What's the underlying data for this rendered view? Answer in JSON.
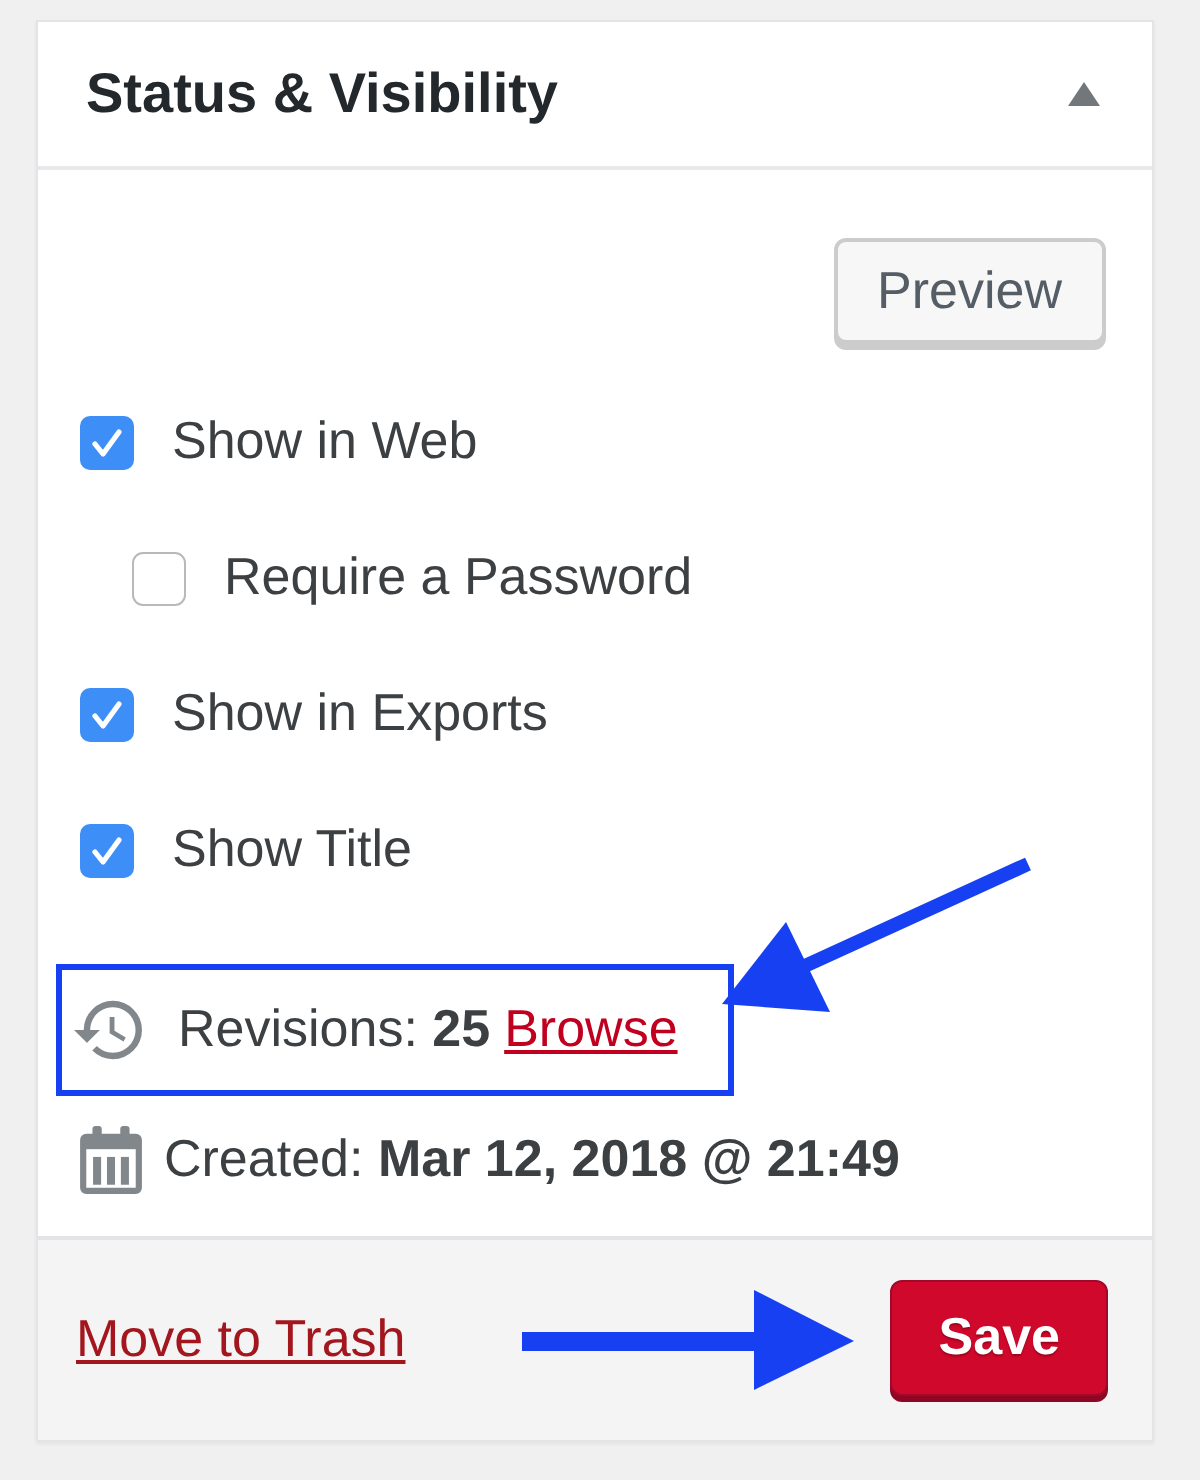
{
  "panel": {
    "title": "Status & Visibility",
    "expanded": true
  },
  "preview_button": {
    "label": "Preview"
  },
  "options": [
    {
      "label": "Show in Web",
      "checked": true,
      "children": [
        {
          "label": "Require a Password",
          "checked": false
        }
      ]
    },
    {
      "label": "Show in Exports",
      "checked": true
    },
    {
      "label": "Show Title",
      "checked": true
    }
  ],
  "revisions": {
    "text": "Revisions: **25**",
    "link": "Browse"
  },
  "created": {
    "text": "Created: **Mar 12, 2018 @ 21:49**"
  },
  "footer": {
    "trash_link": "Move to Trash",
    "save_button": "Save"
  }
}
